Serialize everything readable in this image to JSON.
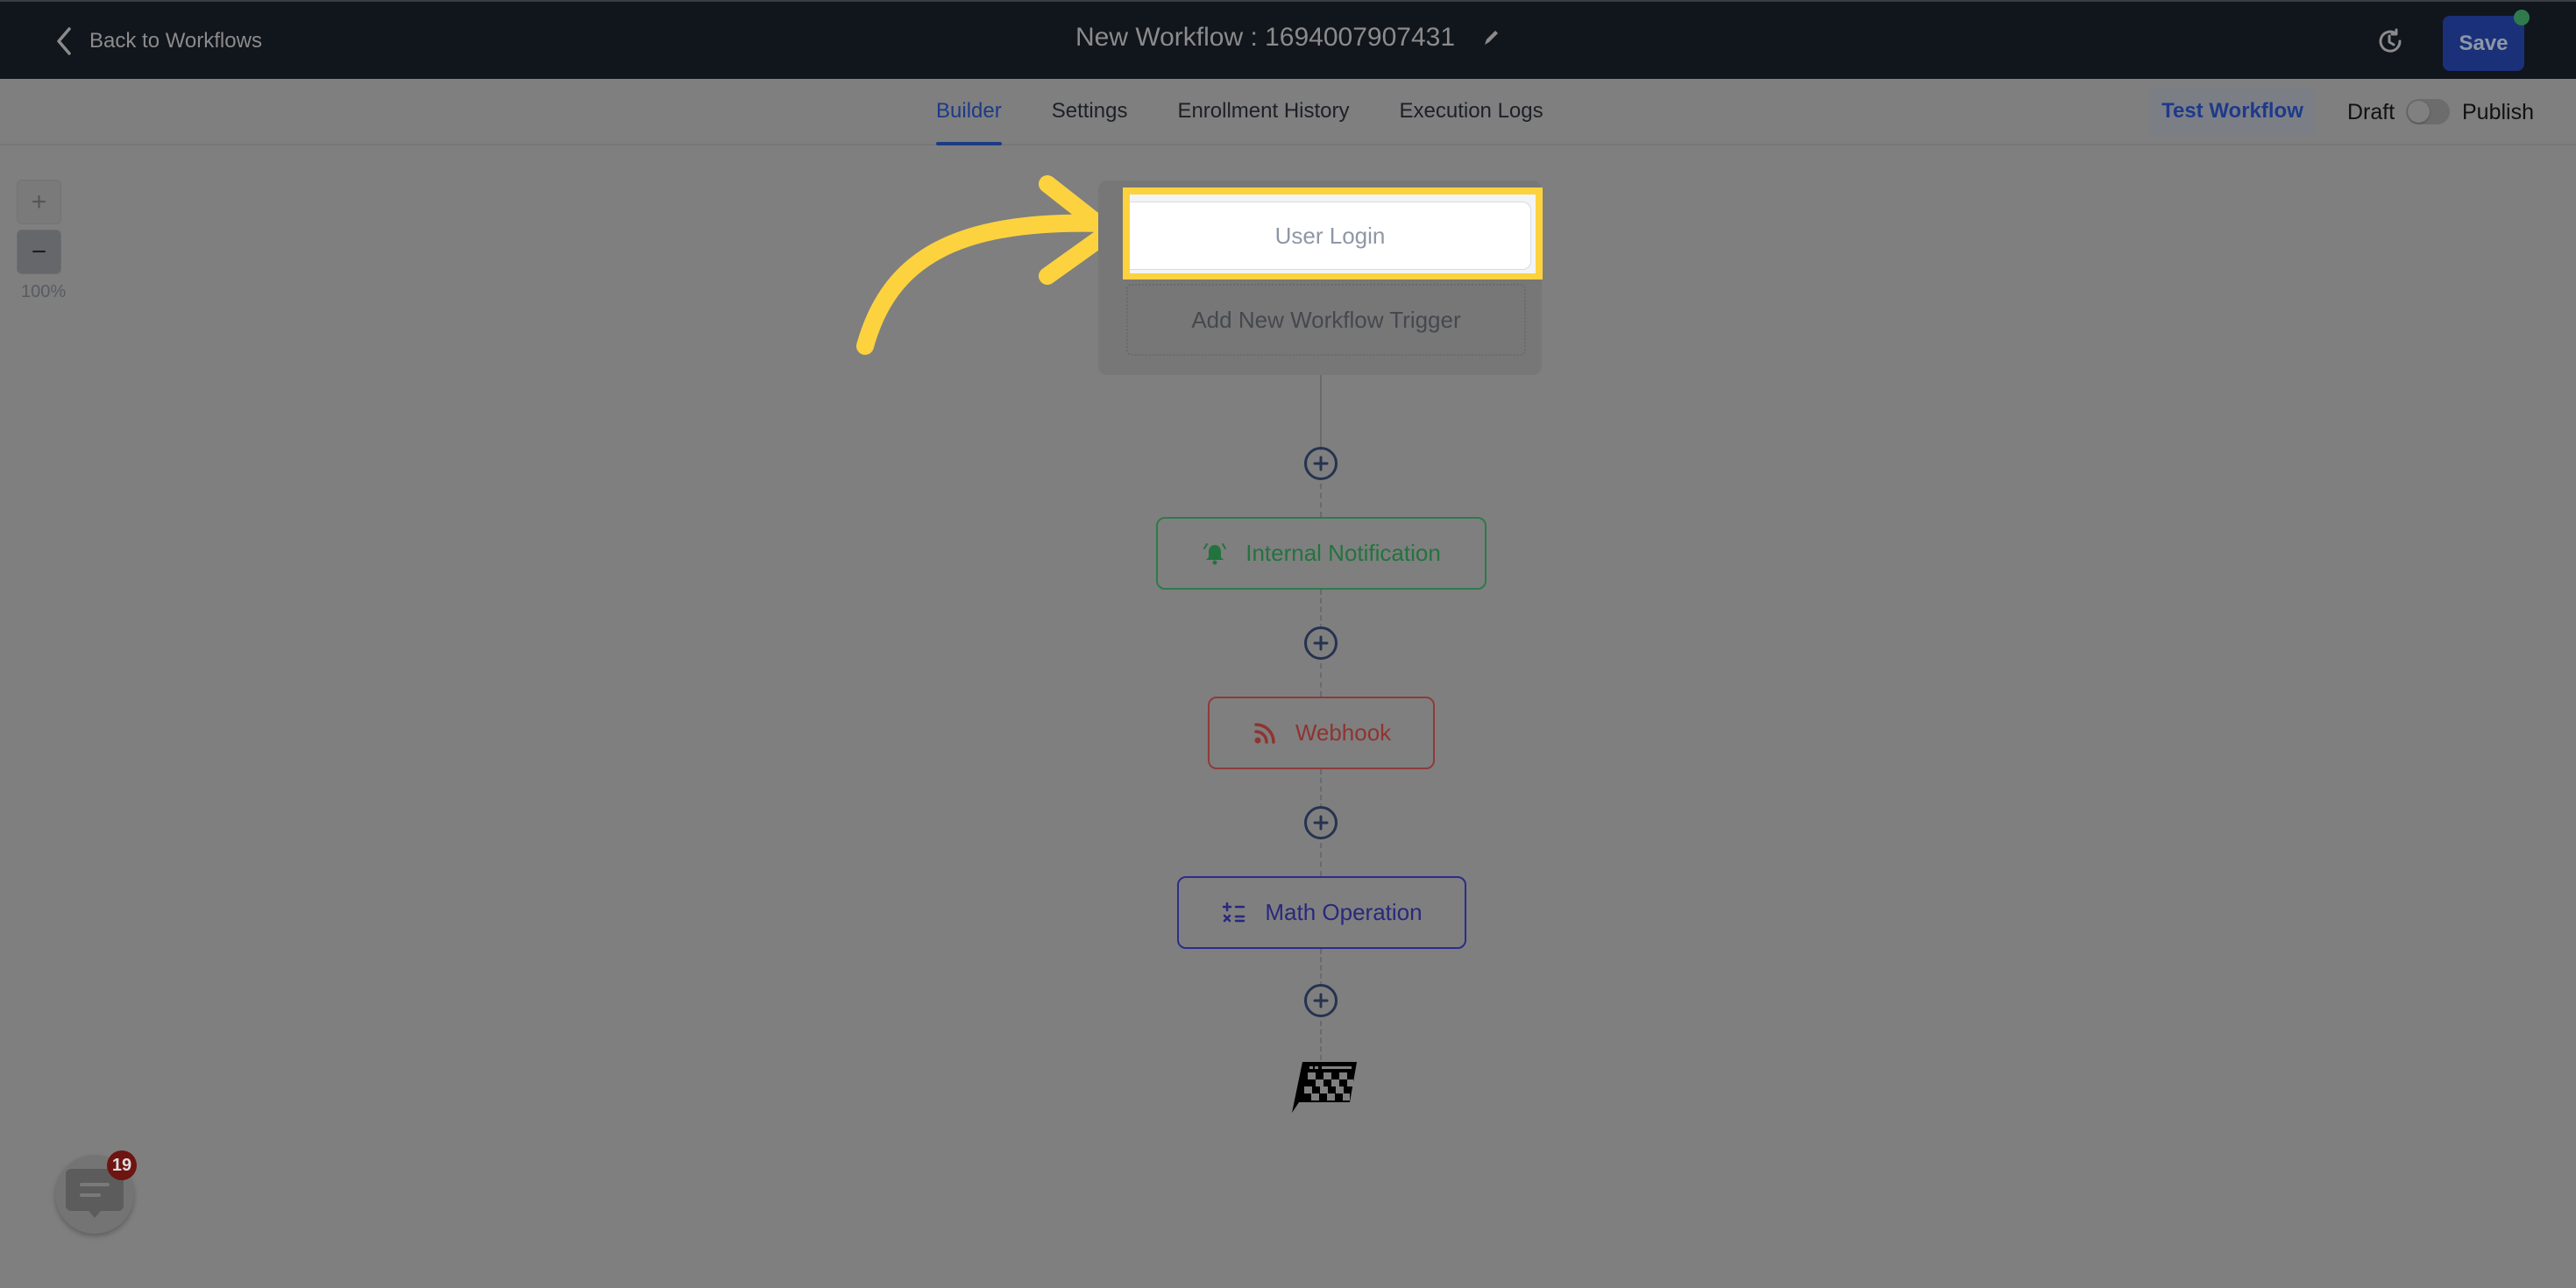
{
  "header": {
    "back_label": "Back to Workflows",
    "workflow_title": "New Workflow : 1694007907431",
    "save_label": "Save",
    "icons": {
      "back": "chevron-left-icon",
      "edit": "pencil-icon",
      "history": "history-clock-icon"
    }
  },
  "nav": {
    "tabs": [
      {
        "label": "Builder",
        "active": true
      },
      {
        "label": "Settings",
        "active": false
      },
      {
        "label": "Enrollment History",
        "active": false
      },
      {
        "label": "Execution Logs",
        "active": false
      }
    ],
    "test_workflow_label": "Test Workflow",
    "draft_label": "Draft",
    "publish_label": "Publish",
    "publish_toggle_on": false
  },
  "zoom_controls": {
    "zoom_in": "+",
    "zoom_out": "−",
    "level": "100%"
  },
  "trigger": {
    "selected_trigger": "User Login",
    "add_trigger_label": "Add New Workflow Trigger"
  },
  "actions": [
    {
      "label": "Internal Notification",
      "icon": "bell-icon",
      "color": "#23733f"
    },
    {
      "label": "Webhook",
      "icon": "rss-icon",
      "color": "#8f3430"
    },
    {
      "label": "Math Operation",
      "icon": "math-operators-icon",
      "color": "#28287e"
    }
  ],
  "end_node": {
    "icon": "checkered-flag-icon"
  },
  "chat_widget": {
    "badge_count": "19"
  },
  "colors": {
    "topbar_bg": "#11151c",
    "accent_blue": "#1c3a86",
    "highlight_yellow": "#fdd23f",
    "overlay_gray": "#7f7f7f"
  }
}
